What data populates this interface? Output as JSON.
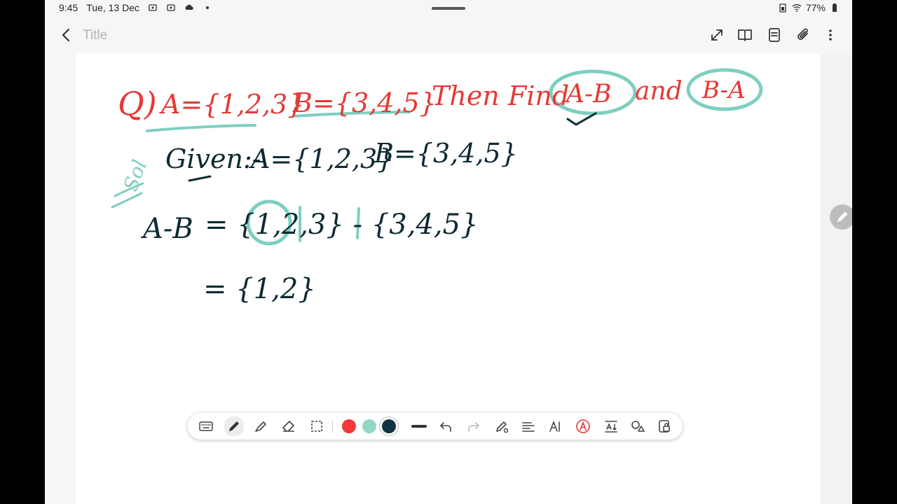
{
  "status_bar": {
    "time": "9:45",
    "date": "Tue, 13 Dec",
    "battery": "77%"
  },
  "app_bar": {
    "title_placeholder": "Title"
  },
  "note": {
    "question": {
      "label": "Q)",
      "set_a": "A={1,2,3}",
      "set_b": "B={3,4,5}",
      "text_then_find": "Then Find",
      "expr1": "A-B",
      "text_and": "and",
      "expr2": "B-A"
    },
    "solution": {
      "sol_label": "Sol",
      "given_label": "Given:-",
      "given_a": "A={1,2,3}",
      "given_b": "B={3,4,5}",
      "step1_lhs": "A-B",
      "step1_rhs": "= {1,2,3} - {3,4,5}",
      "step2": "= {1,2}"
    }
  },
  "toolbar": {
    "colors": [
      "#f0393a",
      "#93d6c8",
      "#0f3342"
    ],
    "selected_color": "#0f3342"
  },
  "colors": {
    "ink_red": "#e53935",
    "ink_teal": "#7ecfc0",
    "ink_dark": "#0d2a33"
  }
}
